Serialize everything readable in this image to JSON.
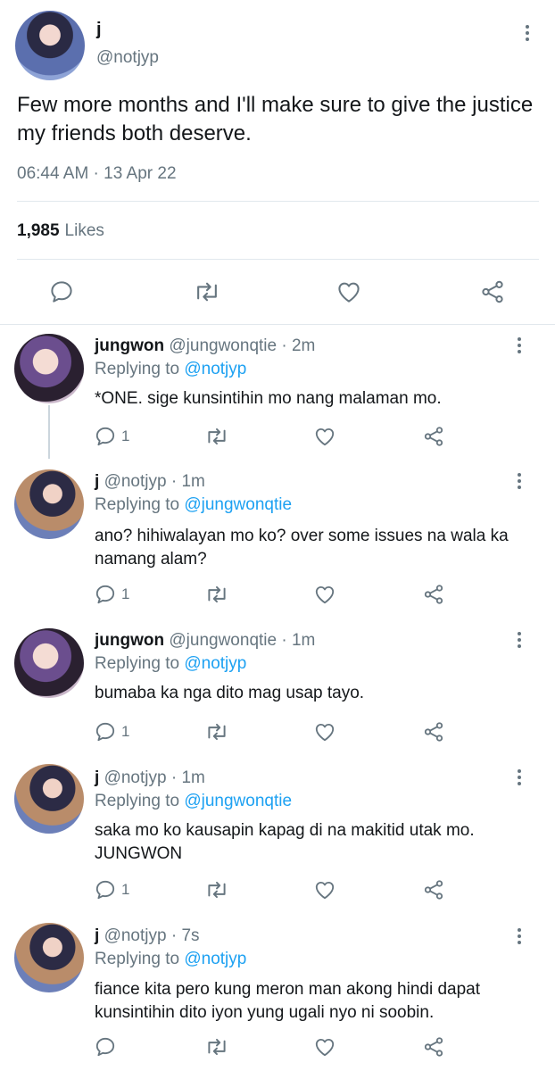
{
  "main_tweet": {
    "name": "j",
    "handle": "@notjyp",
    "text": "Few more months and I'll make sure to give the justice my friends both deserve.",
    "timestamp": "06:44 AM · 13 Apr 22",
    "likes_count": "1,985",
    "likes_label": "Likes",
    "icons": [
      "reply-icon",
      "retweet-icon",
      "like-icon",
      "share-icon"
    ]
  },
  "replies": [
    {
      "name": "jungwon",
      "handle": "@jungwonqtie",
      "time": "· 2m",
      "replying_label": "Replying to",
      "replying_to": "@notjyp",
      "text": "*ONE. sige kunsintihin mo nang malaman mo.",
      "reply_count": "1"
    },
    {
      "name": "j",
      "handle": "@notjyp",
      "time": "· 1m",
      "replying_label": "Replying to",
      "replying_to": "@jungwonqtie",
      "text": "ano? hihiwalayan mo ko? over some issues na wala ka namang alam?",
      "reply_count": "1"
    },
    {
      "name": "jungwon",
      "handle": "@jungwonqtie",
      "time": "· 1m",
      "replying_label": "Replying to",
      "replying_to": "@notjyp",
      "text": "bumaba ka nga dito mag usap tayo.",
      "reply_count": "1"
    },
    {
      "name": "j",
      "handle": "@notjyp",
      "time": "· 1m",
      "replying_label": "Replying to",
      "replying_to": "@jungwonqtie",
      "text": "saka mo ko kausapin kapag di na makitid utak mo. JUNGWON",
      "reply_count": "1"
    },
    {
      "name": "j",
      "handle": "@notjyp",
      "time": "· 7s",
      "replying_label": "Replying to",
      "replying_to": "@notjyp",
      "text": "fiance kita pero kung meron man akong hindi dapat kunsintihin dito iyon yung ugali nyo ni soobin.",
      "reply_count": ""
    }
  ],
  "colors": {
    "text": "#14171a",
    "secondary": "#66757f",
    "link": "#1da1f2",
    "divider": "#e1e8ed"
  }
}
